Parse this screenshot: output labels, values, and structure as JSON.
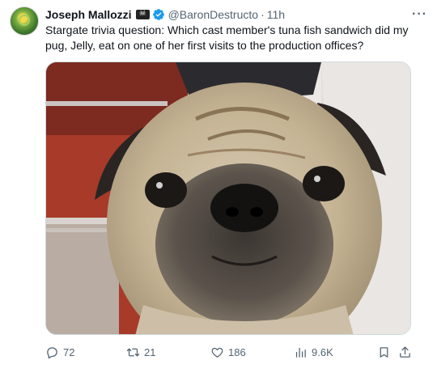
{
  "author": {
    "name": "Joseph Mallozzi",
    "handle": "@BaronDestructo",
    "time": "11h",
    "badge_icon": "pirate-flag-icon",
    "verified_icon": "verified-badge-icon"
  },
  "tweet": {
    "text": "Stargate trivia question: Which cast member's tuna fish sandwich did my pug, Jelly, eat on one of her first visits to the production offices?"
  },
  "media": {
    "alt_subject": "pug"
  },
  "metrics": {
    "replies": "72",
    "reposts": "21",
    "likes": "186",
    "views": "9.6K"
  },
  "colors": {
    "text": "#0f1419",
    "secondary": "#536471",
    "verified": "#1d9bf0",
    "border": "#cfd9de"
  }
}
